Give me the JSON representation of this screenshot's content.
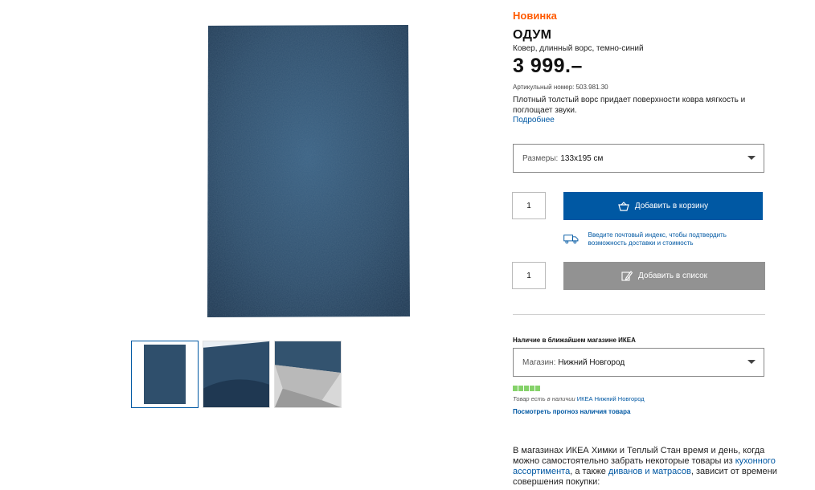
{
  "product": {
    "badge": "Новинка",
    "name": "ОДУМ",
    "description": "Ковер, длинный ворс, темно-синий",
    "price": "3 999.–",
    "article_label": "Артикульный номер: 503.981.30",
    "text": "Плотный толстый ворс придает поверхности ковра мягкость и поглощает звуки.",
    "more_link": "Подробнее"
  },
  "size_select": {
    "label": "Размеры:",
    "value": "133x195 см"
  },
  "cart": {
    "quantity": "1",
    "add_to_cart": "Добавить в корзину"
  },
  "delivery": {
    "text": "Введите почтовый индекс, чтобы подтвердить возможность доставки и стоимость"
  },
  "list": {
    "quantity": "1",
    "add_to_list": "Добавить в список"
  },
  "stock": {
    "title": "Наличие в ближайшем магазине ИКЕА",
    "store_label": "Магазин:",
    "store_value": "Нижний Новгород",
    "availability_prefix": "Товар есть в наличии",
    "availability_store": "ИКЕА Нижний Новгород",
    "forecast_link": "Посмотреть прогноз наличия товара",
    "level_bars": 5
  },
  "bottom": {
    "part1": "В магазинах ИКЕА Химки и Теплый Стан время и день, когда можно самостоятельно забрать некоторые товары из ",
    "link1": "кухонного ассортимента",
    "part2": ", а также ",
    "link2": "диванов и матрасов",
    "part3": ", зависит от времени совершения покупки:"
  },
  "colors": {
    "brand_blue": "#0058a3",
    "badge_orange": "#ff5a00",
    "rug_blue": "#2f4f6c",
    "stock_green": "#85d26a"
  },
  "icons": {
    "cart": "basket-icon",
    "list": "pencil-list-icon",
    "delivery": "truck-icon"
  }
}
